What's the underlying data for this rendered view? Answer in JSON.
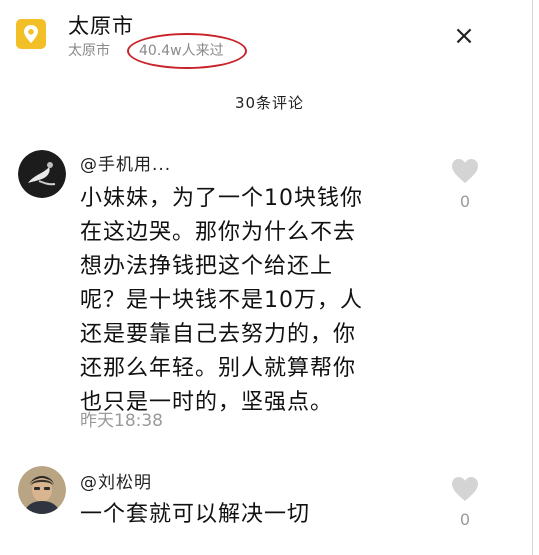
{
  "location": {
    "title": "太原市",
    "subtitle": "太原市",
    "visitors": "40.4w人来过",
    "icon": "map-pin-icon",
    "icon_color": "#f2bf26",
    "highlight_color": "#c8232a"
  },
  "close_icon": "×",
  "comments_title": "30条评论",
  "comments": [
    {
      "user": "@手机用...",
      "lines": [
        "小妹妹，为了一个10块钱你",
        "在这边哭。那你为什么不去",
        "想办法挣钱把这个给还上",
        "呢？是十块钱不是10万，人",
        "还是要靠自己去努力的，你",
        "还那么年轻。别人就算帮你",
        "也只是一时的，坚强点。"
      ],
      "time": "昨天18:38",
      "likes": "0"
    },
    {
      "user": "@刘松明",
      "lines": [
        "一个套就可以解决一切"
      ],
      "time": "",
      "likes": "0"
    }
  ]
}
